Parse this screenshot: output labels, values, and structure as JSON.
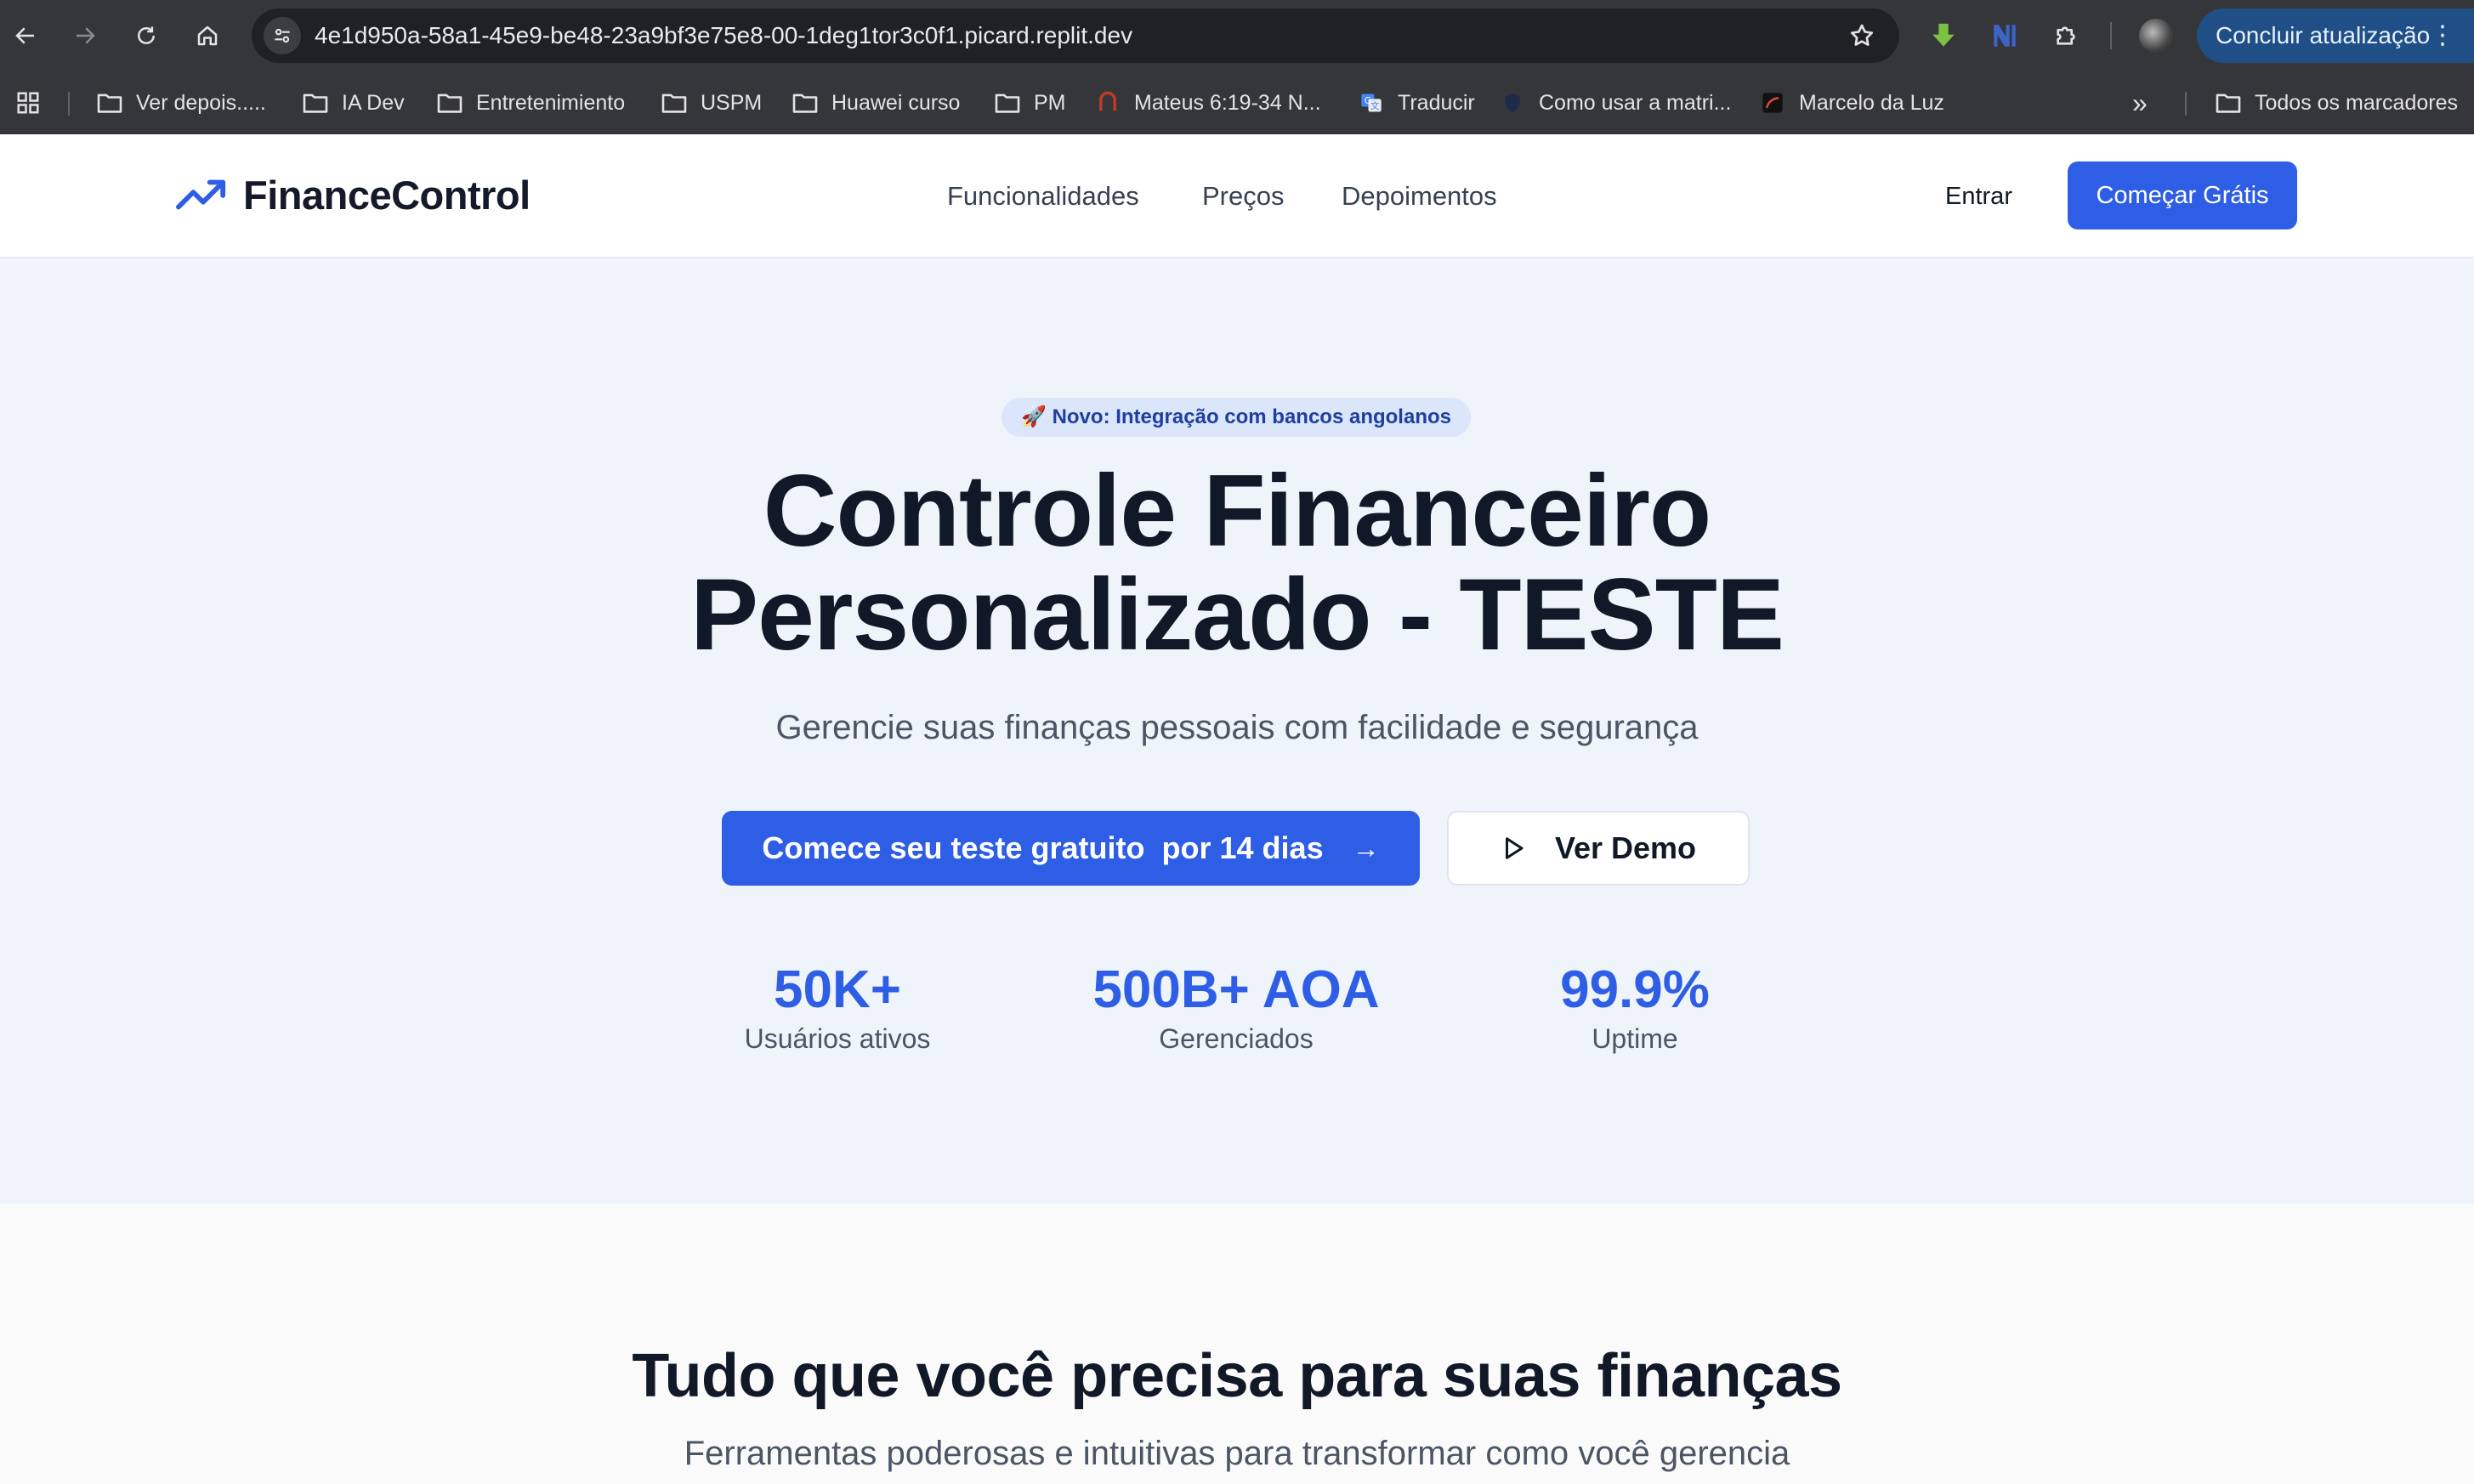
{
  "browser": {
    "url": "4e1d950a-58a1-45e9-be48-23a9bf3e75e8-00-1deg1tor3c0f1.picard.replit.dev",
    "update_label": "Concluir atualização",
    "bookmarks": [
      "Ver depois.....",
      "IA Dev",
      "Entretenimiento",
      "USPM",
      "Huawei curso",
      "PM",
      "Mateus 6:19-34 N...",
      "Traducir",
      "Como usar a matri...",
      "Marcelo da Luz"
    ],
    "all_bookmarks_label": "Todos os marcadores"
  },
  "header": {
    "logo_text": "FinanceControl",
    "nav": [
      "Funcionalidades",
      "Preços",
      "Depoimentos"
    ],
    "login_label": "Entrar",
    "cta_label": "Começar Grátis"
  },
  "hero": {
    "badge": "🚀 Novo: Integração com bancos angolanos",
    "title_line1": "Controle Financeiro",
    "title_line2": "Personalizado - TESTE",
    "subtitle": "Gerencie suas finanças pessoais com facilidade e segurança",
    "primary_cta": "Comece seu teste gratuito  por 14 dias",
    "secondary_cta": "Ver Demo",
    "stats": [
      {
        "value": "50K+",
        "label": "Usuários ativos"
      },
      {
        "value": "500B+ AOA",
        "label": "Gerenciados"
      },
      {
        "value": "99.9%",
        "label": "Uptime"
      }
    ]
  },
  "features": {
    "title": "Tudo que você precisa para suas finanças",
    "subtitle": "Ferramentas poderosas e intuitivas para transformar como você gerencia"
  },
  "colors": {
    "primary": "#2f5ee6",
    "hero_bg": "#eff4fa",
    "chrome": "#35363a"
  }
}
